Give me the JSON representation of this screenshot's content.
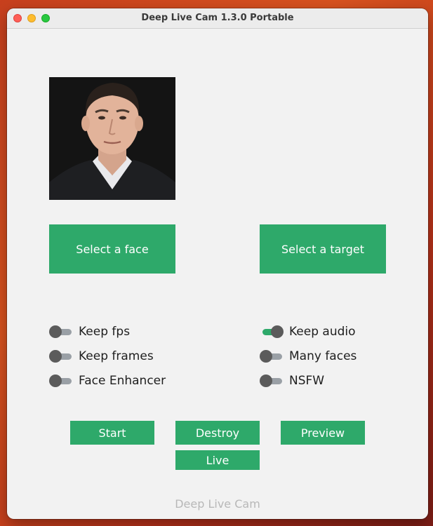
{
  "window": {
    "title": "Deep Live Cam 1.3.0 Portable"
  },
  "source_preview": {
    "icon": "face-photo"
  },
  "buttons": {
    "select_face": "Select a face",
    "select_target": "Select a target",
    "start": "Start",
    "destroy": "Destroy",
    "preview": "Preview",
    "live": "Live"
  },
  "switches": {
    "keep_fps": {
      "label": "Keep fps",
      "on": false
    },
    "keep_frames": {
      "label": "Keep frames",
      "on": false
    },
    "face_enhancer": {
      "label": "Face Enhancer",
      "on": false
    },
    "keep_audio": {
      "label": "Keep audio",
      "on": true
    },
    "many_faces": {
      "label": "Many faces",
      "on": false
    },
    "nsfw": {
      "label": "NSFW",
      "on": false
    }
  },
  "footer": {
    "text": "Deep Live Cam"
  },
  "colors": {
    "accent": "#2ea96a",
    "window_bg": "#f2f2f2",
    "switch_off_track": "#9aa0a6",
    "switch_knob": "#5b5b5b"
  }
}
